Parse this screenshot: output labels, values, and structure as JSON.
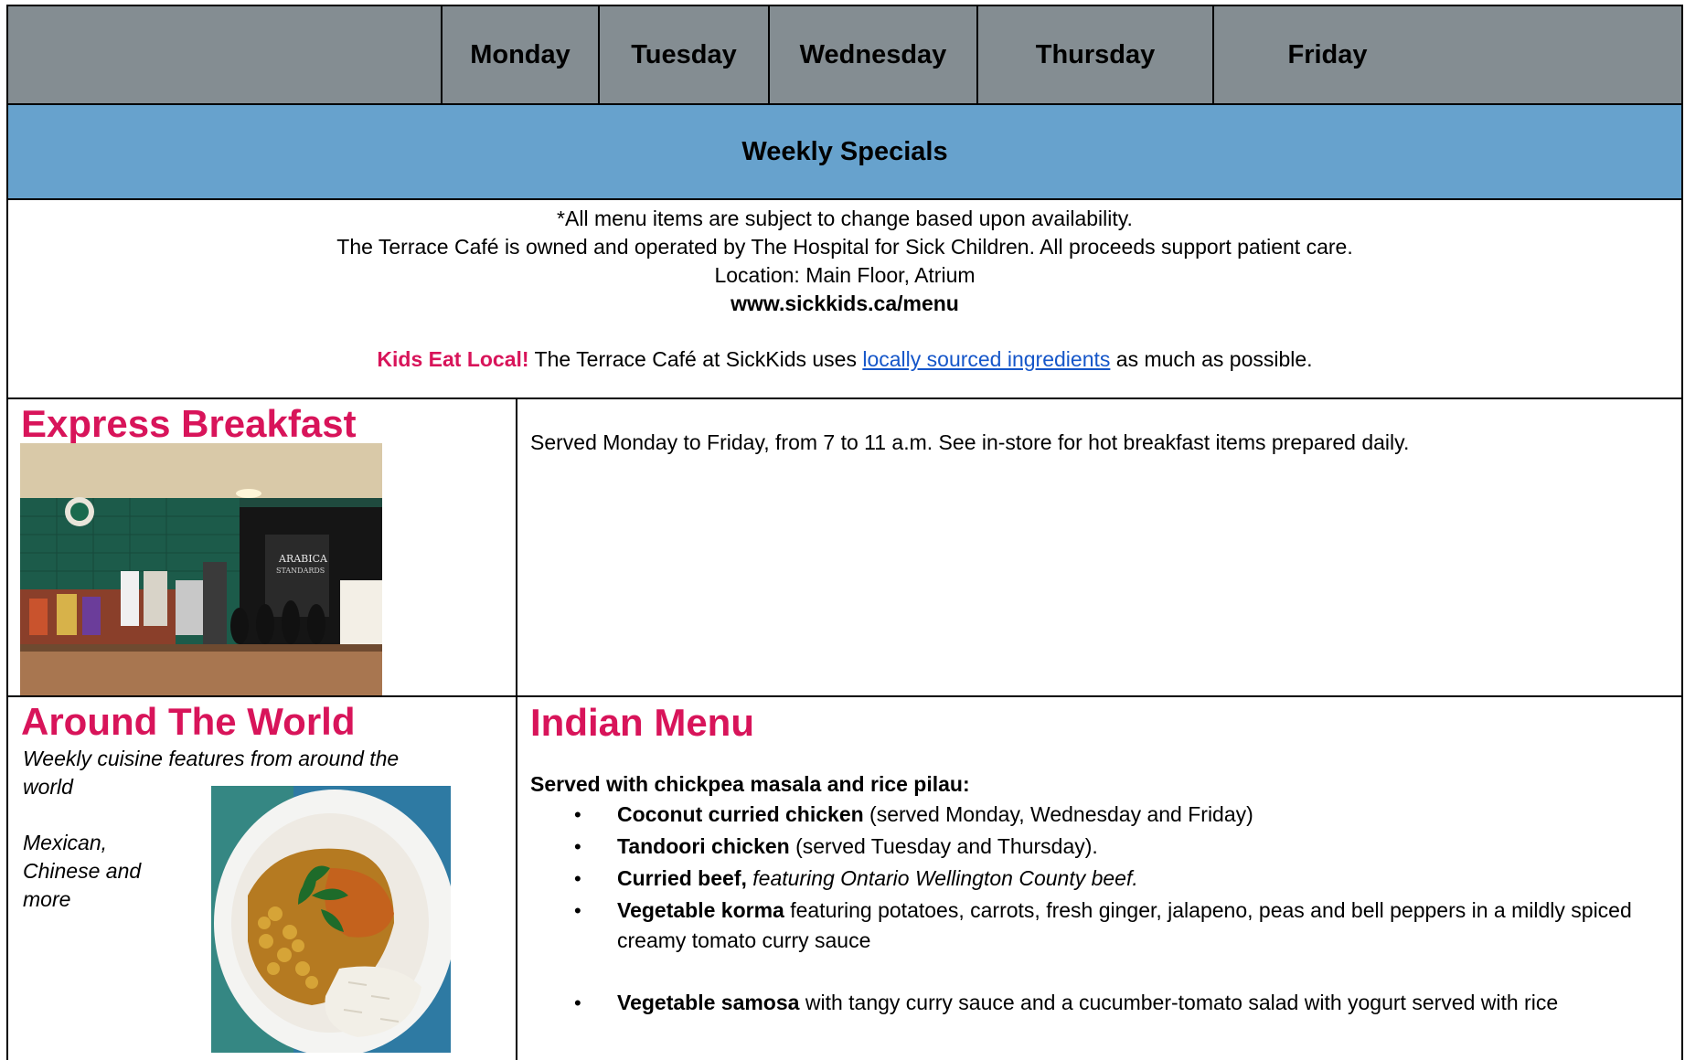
{
  "header": {
    "blank": "",
    "days": [
      "Monday",
      "Tuesday",
      "Wednesday",
      "Thursday",
      "Friday"
    ]
  },
  "specials_title": "Weekly Specials",
  "info": {
    "line1": "*All menu items are subject to change based upon availability.",
    "line2": "The Terrace Café is owned and operated by The Hospital for Sick Children. All proceeds support patient care.",
    "line3": "Location: Main Floor, Atrium",
    "url": "www.sickkids.ca/menu",
    "kids_eat_local": "Kids Eat Local!",
    "local_before": " The Terrace Café at SickKids uses ",
    "local_link": "locally sourced ingredients",
    "local_after": " as much as possible."
  },
  "express_breakfast": {
    "title": "Express Breakfast",
    "description": "Served Monday to Friday, from 7 to 11 a.m. See in-store for hot breakfast items prepared daily."
  },
  "around_the_world": {
    "title": "Around The World",
    "description_line1": "Weekly cuisine features from around the",
    "description_line2": "world",
    "sub_line1": "Mexican,",
    "sub_line2": "Chinese and",
    "sub_line3": "more"
  },
  "indian_menu": {
    "title": "Indian Menu",
    "intro": "Served with chickpea masala and rice pilau:",
    "items": [
      {
        "name": "Coconut curried chicken",
        "detail": " (served Monday, Wednesday and Friday)"
      },
      {
        "name": "Tandoori chicken",
        "detail": " (served Tuesday and Thursday)."
      },
      {
        "name": "Curried beef,",
        "detail": " featuring Ontario Wellington County beef."
      },
      {
        "name": "Vegetable korma",
        "detail": " featuring potatoes, carrots, fresh ginger, jalapeno, peas and bell peppers in a mildly spiced creamy tomato curry sauce"
      },
      {
        "name": "Vegetable samosa",
        "detail": " with tangy curry sauce and a cucumber-tomato salad with yogurt served with rice"
      }
    ]
  },
  "colors": {
    "header_bg": "#848d92",
    "specials_bg": "#67a2cd",
    "accent_pink": "#d8145a",
    "link_blue": "#1556c9"
  }
}
